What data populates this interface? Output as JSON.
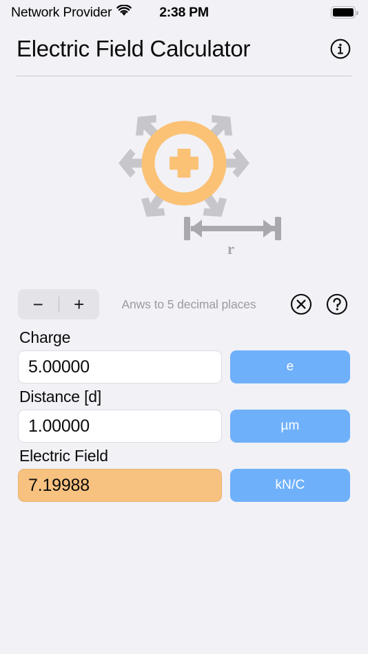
{
  "status_bar": {
    "carrier": "Network Provider",
    "wifi_icon": "wifi-icon",
    "time": "2:38 PM",
    "battery_icon": "battery-full-icon"
  },
  "header": {
    "title": "Electric Field Calculator",
    "info_icon": "info-circle-icon"
  },
  "diagram": {
    "name": "point-charge-field-diagram",
    "charge_sign": "+",
    "charge_color": "#fbc276",
    "arrow_color": "#c6c6cb",
    "distance_label": "r",
    "field_arrow_count": 6
  },
  "toolbar": {
    "decrease_label": "−",
    "increase_label": "+",
    "precision_hint": "Anws to 5 decimal places",
    "clear_icon": "clear-circle-x-icon",
    "help_icon": "help-circle-question-icon"
  },
  "fields": [
    {
      "label": "Charge",
      "value": "5.00000",
      "unit": "e",
      "is_result": false,
      "name": "charge"
    },
    {
      "label": "Distance [d]",
      "value": "1.00000",
      "unit": "µm",
      "is_result": false,
      "name": "distance"
    },
    {
      "label": "Electric Field",
      "value": "7.19988",
      "unit": "kN/C",
      "is_result": true,
      "name": "electric-field"
    }
  ],
  "colors": {
    "background": "#f1f1f6",
    "accent_blue": "#6fb0fa",
    "result_orange": "#f7c280",
    "stepper_gray": "#e3e3e8",
    "hint_gray": "#9a9aa2"
  }
}
